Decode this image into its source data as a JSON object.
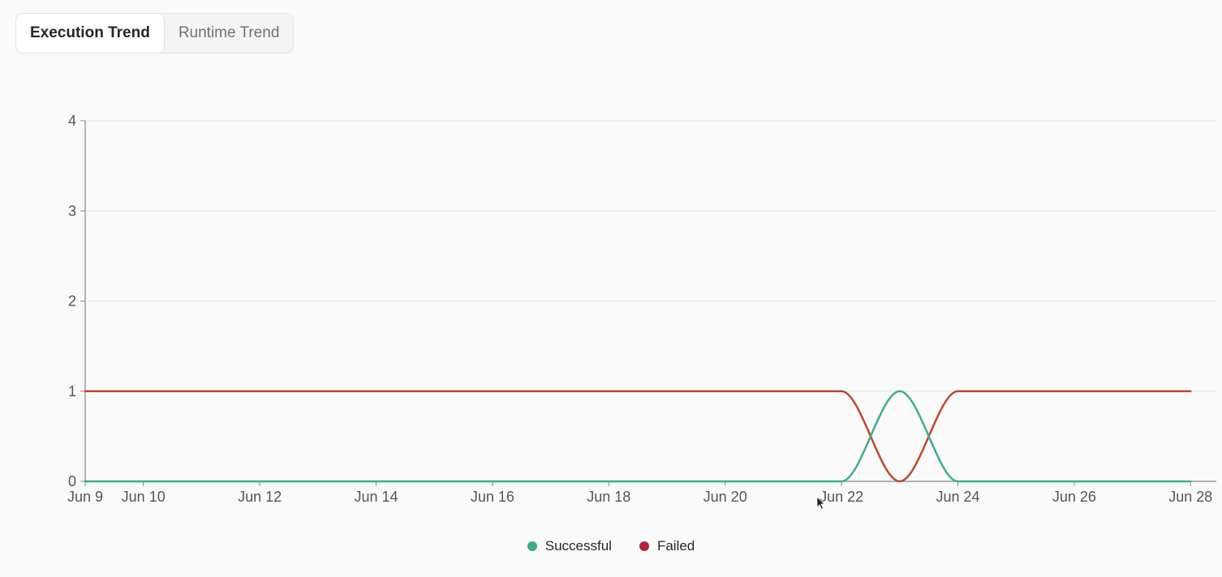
{
  "tabs": [
    {
      "label": "Execution Trend",
      "active": true
    },
    {
      "label": "Runtime Trend",
      "active": false
    }
  ],
  "colors": {
    "successful": "#3aae8f",
    "failed": "#c0472a",
    "failed_legend": "#b8233c",
    "grid": "#e5e5e5",
    "axis": "#888888",
    "tick_text": "#555555"
  },
  "chart_data": {
    "type": "line",
    "title": "",
    "xlabel": "",
    "ylabel": "",
    "x": [
      "Jun 9",
      "Jun 10",
      "Jun 11",
      "Jun 12",
      "Jun 13",
      "Jun 14",
      "Jun 15",
      "Jun 16",
      "Jun 17",
      "Jun 18",
      "Jun 19",
      "Jun 20",
      "Jun 21",
      "Jun 22",
      "Jun 23",
      "Jun 24",
      "Jun 25",
      "Jun 26",
      "Jun 27",
      "Jun 28"
    ],
    "x_ticks": [
      "Jun 9",
      "Jun 10",
      "Jun 12",
      "Jun 14",
      "Jun 16",
      "Jun 18",
      "Jun 20",
      "Jun 22",
      "Jun 24",
      "Jun 26",
      "Jun 28"
    ],
    "ylim": [
      0,
      4
    ],
    "y_ticks": [
      0,
      1,
      2,
      3,
      4
    ],
    "grid": true,
    "legend_position": "bottom-center",
    "series": [
      {
        "name": "Successful",
        "values": [
          0,
          0,
          0,
          0,
          0,
          0,
          0,
          0,
          0,
          0,
          0,
          0,
          0,
          0,
          1,
          0,
          0,
          0,
          0,
          0
        ]
      },
      {
        "name": "Failed",
        "values": [
          1,
          1,
          1,
          1,
          1,
          1,
          1,
          1,
          1,
          1,
          1,
          1,
          1,
          1,
          0,
          1,
          1,
          1,
          1,
          1
        ]
      }
    ]
  }
}
